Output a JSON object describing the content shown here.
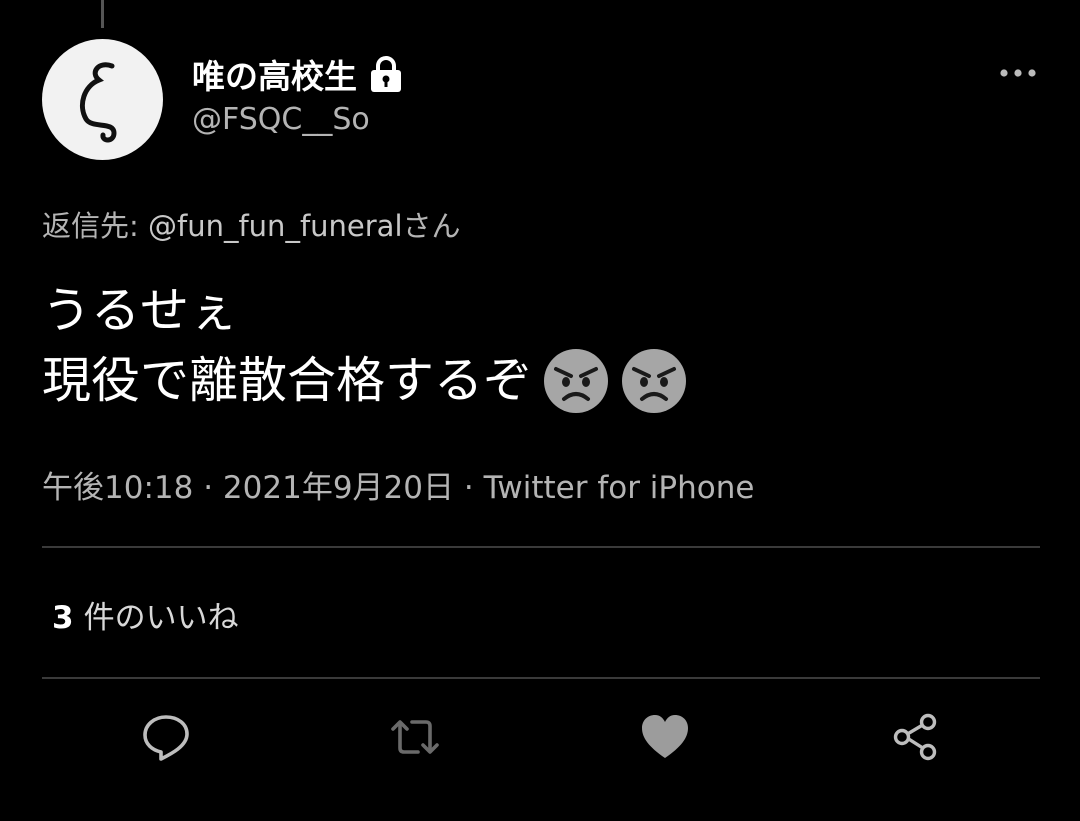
{
  "author": {
    "display_name": "唯の高校生",
    "handle": "@FSQC__So",
    "protected_icon": "lock-icon",
    "avatar_glyph": "ζ"
  },
  "reply_to": {
    "prefix": "返信先:",
    "mention": "@fun_fun_funeral",
    "suffix": "さん"
  },
  "tweet": {
    "lines": [
      "うるせぇ",
      "現役で離散合格するぞ"
    ],
    "emoji": [
      "angry-face-emoji",
      "angry-face-emoji"
    ]
  },
  "meta": {
    "time": "午後10:18",
    "date": "2021年9月20日",
    "source": "Twitter for iPhone",
    "separator": "·"
  },
  "likes": {
    "count": "3",
    "label": "件のいいね"
  },
  "actions": [
    "reply-icon",
    "retweet-icon",
    "like-icon",
    "share-icon"
  ],
  "menu_icon": "more-icon"
}
